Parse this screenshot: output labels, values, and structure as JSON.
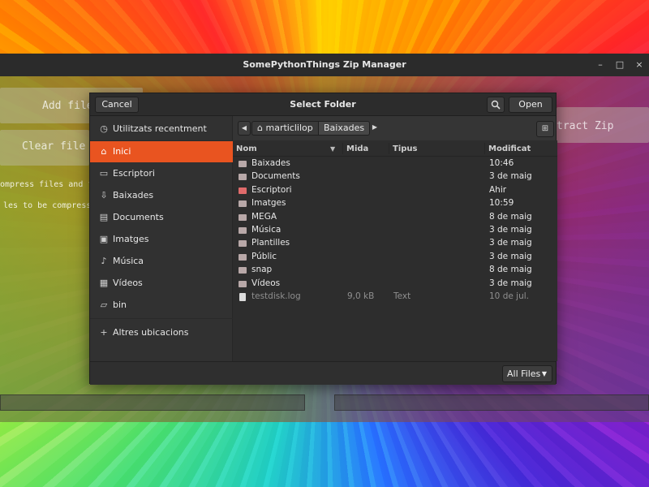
{
  "app": {
    "title": "SomePythonThings Zip Manager",
    "window_controls": [
      "–",
      "□",
      "×"
    ],
    "background_labels": {
      "add_files": "Add file",
      "clear_file_list": "Clear file l",
      "extract_zip": "tract Zip",
      "compress_hint": "ompress files and f",
      "files_hint": "les to be compress"
    }
  },
  "dialog": {
    "title": "Select Folder",
    "cancel_label": "Cancel",
    "open_label": "Open",
    "search_icon": "search-icon",
    "filter_label": "All Files",
    "accent_color": "#e95420"
  },
  "sidebar": {
    "items": [
      {
        "label": "Utilitzats recentment",
        "icon": "clock-icon"
      },
      {
        "label": "Inici",
        "icon": "home-icon",
        "active": true
      },
      {
        "label": "Escriptori",
        "icon": "desktop-icon"
      },
      {
        "label": "Baixades",
        "icon": "download-icon"
      },
      {
        "label": "Documents",
        "icon": "document-icon"
      },
      {
        "label": "Imatges",
        "icon": "image-icon"
      },
      {
        "label": "Música",
        "icon": "music-icon"
      },
      {
        "label": "Vídeos",
        "icon": "video-icon"
      },
      {
        "label": "bin",
        "icon": "folder-icon"
      },
      {
        "label": "Altres ubicacions",
        "icon": "plus-icon"
      }
    ]
  },
  "pathbar": {
    "segments": [
      "marticlilop",
      "Baixades"
    ]
  },
  "filelist": {
    "columns": [
      "Nom",
      "Mida",
      "Tipus",
      "Modificat"
    ],
    "rows": [
      {
        "name": "Baixades",
        "size": "",
        "type": "",
        "modified": "10:46"
      },
      {
        "name": "Documents",
        "size": "",
        "type": "",
        "modified": "3 de maig"
      },
      {
        "name": "Escriptori",
        "size": "",
        "type": "",
        "modified": "Ahir"
      },
      {
        "name": "Imatges",
        "size": "",
        "type": "",
        "modified": "10:59"
      },
      {
        "name": "MEGA",
        "size": "",
        "type": "",
        "modified": "8 de maig"
      },
      {
        "name": "Música",
        "size": "",
        "type": "",
        "modified": "3 de maig"
      },
      {
        "name": "Plantilles",
        "size": "",
        "type": "",
        "modified": "3 de maig"
      },
      {
        "name": "Públic",
        "size": "",
        "type": "",
        "modified": "3 de maig"
      },
      {
        "name": "snap",
        "size": "",
        "type": "",
        "modified": "8 de maig"
      },
      {
        "name": "Vídeos",
        "size": "",
        "type": "",
        "modified": "3 de maig"
      },
      {
        "name": "testdisk.log",
        "size": "9,0 kB",
        "type": "Text",
        "modified": "10 de jul."
      }
    ]
  }
}
